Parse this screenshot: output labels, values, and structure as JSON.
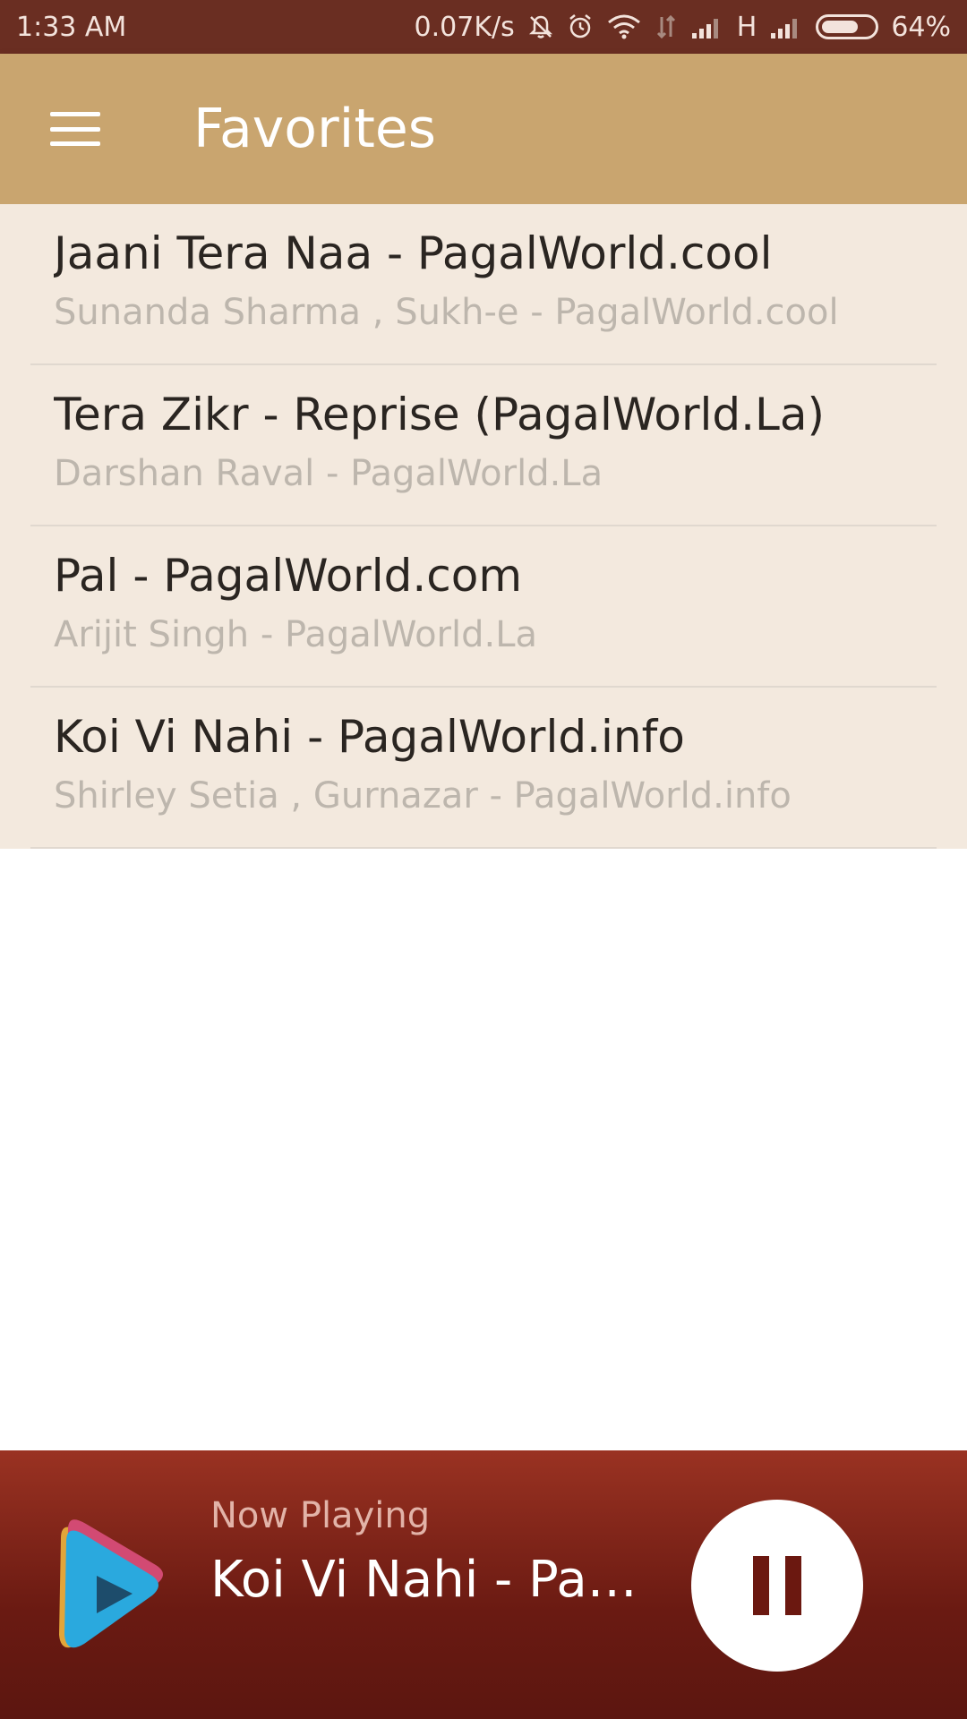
{
  "status_bar": {
    "time": "1:33 AM",
    "network_speed": "0.07K/s",
    "network_type": "H",
    "battery": "64%",
    "icons": [
      "mute-icon",
      "alarm-icon",
      "wifi-icon",
      "data-arrows-icon",
      "signal-icon",
      "signal-icon-2",
      "battery-icon"
    ]
  },
  "app_bar": {
    "title": "Favorites",
    "menu_icon": "hamburger-menu-icon"
  },
  "favorites": [
    {
      "title": "Jaani Tera Naa - PagalWorld.cool",
      "subtitle": "Sunanda Sharma , Sukh-e - PagalWorld.cool"
    },
    {
      "title": "Tera Zikr - Reprise (PagalWorld.La)",
      "subtitle": "Darshan Raval - PagalWorld.La"
    },
    {
      "title": "Pal - PagalWorld.com",
      "subtitle": "Arijit Singh - PagalWorld.La"
    },
    {
      "title": "Koi Vi Nahi - PagalWorld.info",
      "subtitle": "Shirley Setia , Gurnazar - PagalWorld.info"
    }
  ],
  "now_playing": {
    "label": "Now Playing",
    "track": "Koi Vi Nahi - Pa…",
    "logo_icon": "play-logo-icon",
    "control_icon": "pause-icon"
  },
  "colors": {
    "status_bar": "#6a2e22",
    "app_bar": "#c9a56f",
    "list_background": "#f3e9de",
    "now_playing_top": "#9a3222",
    "now_playing_bottom": "#5c1610"
  }
}
